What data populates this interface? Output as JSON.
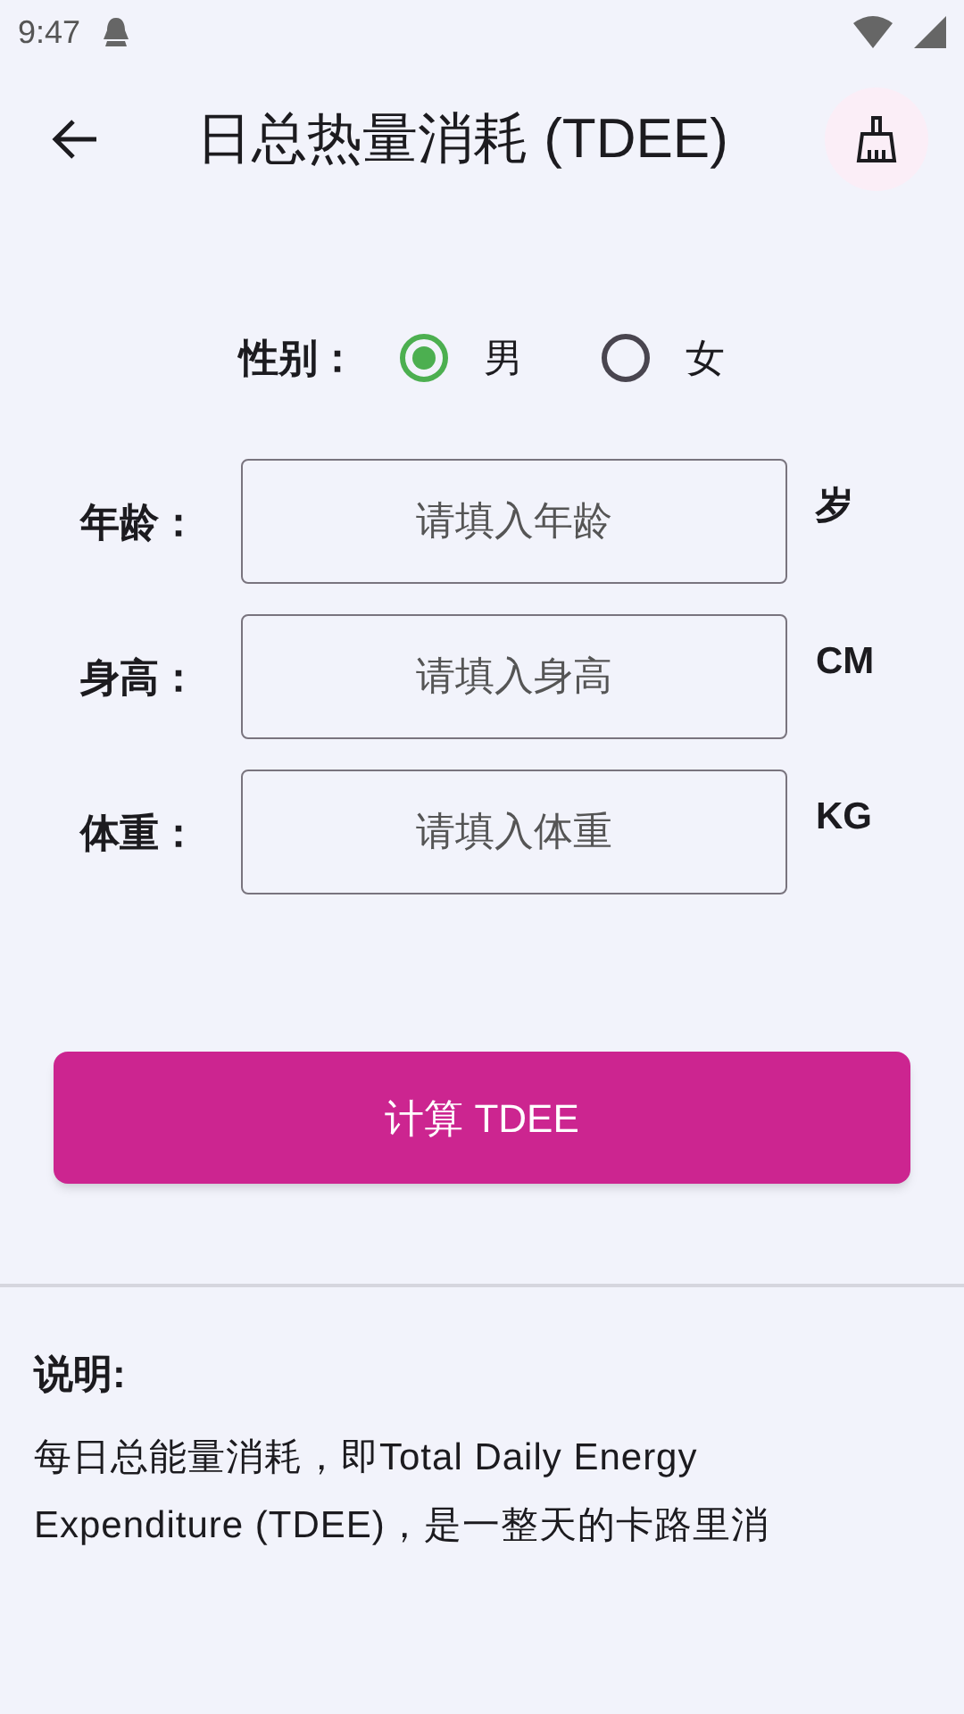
{
  "status_bar": {
    "time": "9:47"
  },
  "header": {
    "title": "日总热量消耗 (TDEE)"
  },
  "gender": {
    "label": "性别：",
    "options": [
      {
        "label": "男",
        "selected": true
      },
      {
        "label": "女",
        "selected": false
      }
    ]
  },
  "fields": [
    {
      "label": "年龄：",
      "placeholder": "请填入年龄",
      "unit": "岁"
    },
    {
      "label": "身高：",
      "placeholder": "请填入身高",
      "unit": "CM"
    },
    {
      "label": "体重：",
      "placeholder": "请填入体重",
      "unit": "KG"
    }
  ],
  "calculate_button": "计算 TDEE",
  "note": {
    "title": "说明:",
    "text": "每日总能量消耗，即Total Daily Energy Expenditure (TDEE)，是一整天的卡路里消"
  }
}
